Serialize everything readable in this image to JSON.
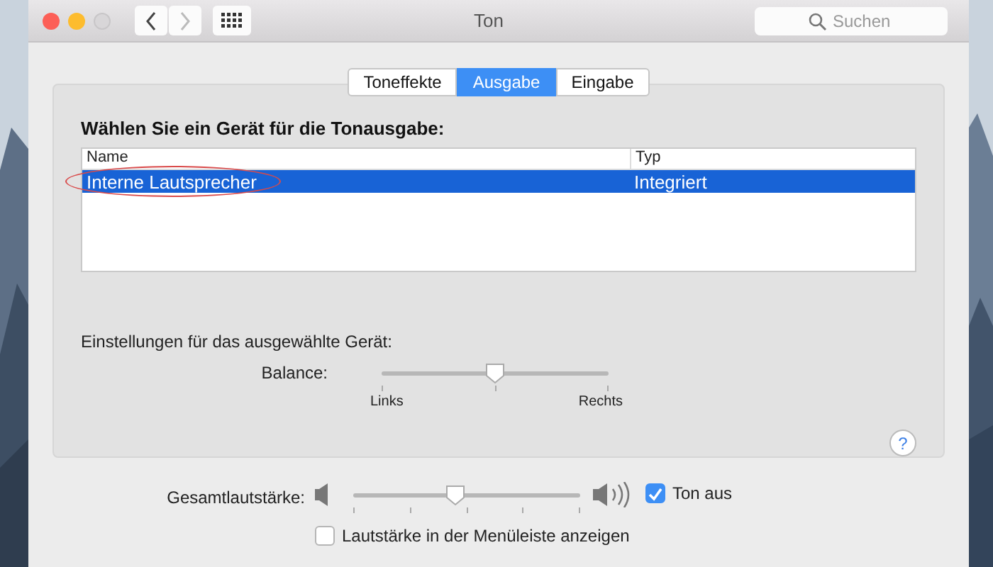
{
  "window": {
    "title": "Ton"
  },
  "search": {
    "placeholder": "Suchen"
  },
  "tabs": [
    {
      "label": "Toneffekte",
      "selected": false
    },
    {
      "label": "Ausgabe",
      "selected": true
    },
    {
      "label": "Eingabe",
      "selected": false
    }
  ],
  "device_heading": "Wählen Sie ein Gerät für die Tonausgabe:",
  "table": {
    "columns": [
      "Name",
      "Typ"
    ],
    "rows": [
      {
        "cells": [
          "Interne Lautsprecher",
          "Integriert"
        ],
        "selected": true,
        "circled": true
      }
    ]
  },
  "settings_heading": "Einstellungen für das ausgewählte Gerät:",
  "balance": {
    "label": "Balance:",
    "level": 0.5,
    "left_label": "Links",
    "right_label": "Rechts"
  },
  "help_button": "?",
  "volume": {
    "label": "Gesamtlautstärke:",
    "level": 0.45
  },
  "checkboxes": [
    {
      "label": "Ton aus",
      "checked": true
    },
    {
      "label": "Lautstärke in der Menüleiste anzeigen",
      "checked": false
    }
  ]
}
